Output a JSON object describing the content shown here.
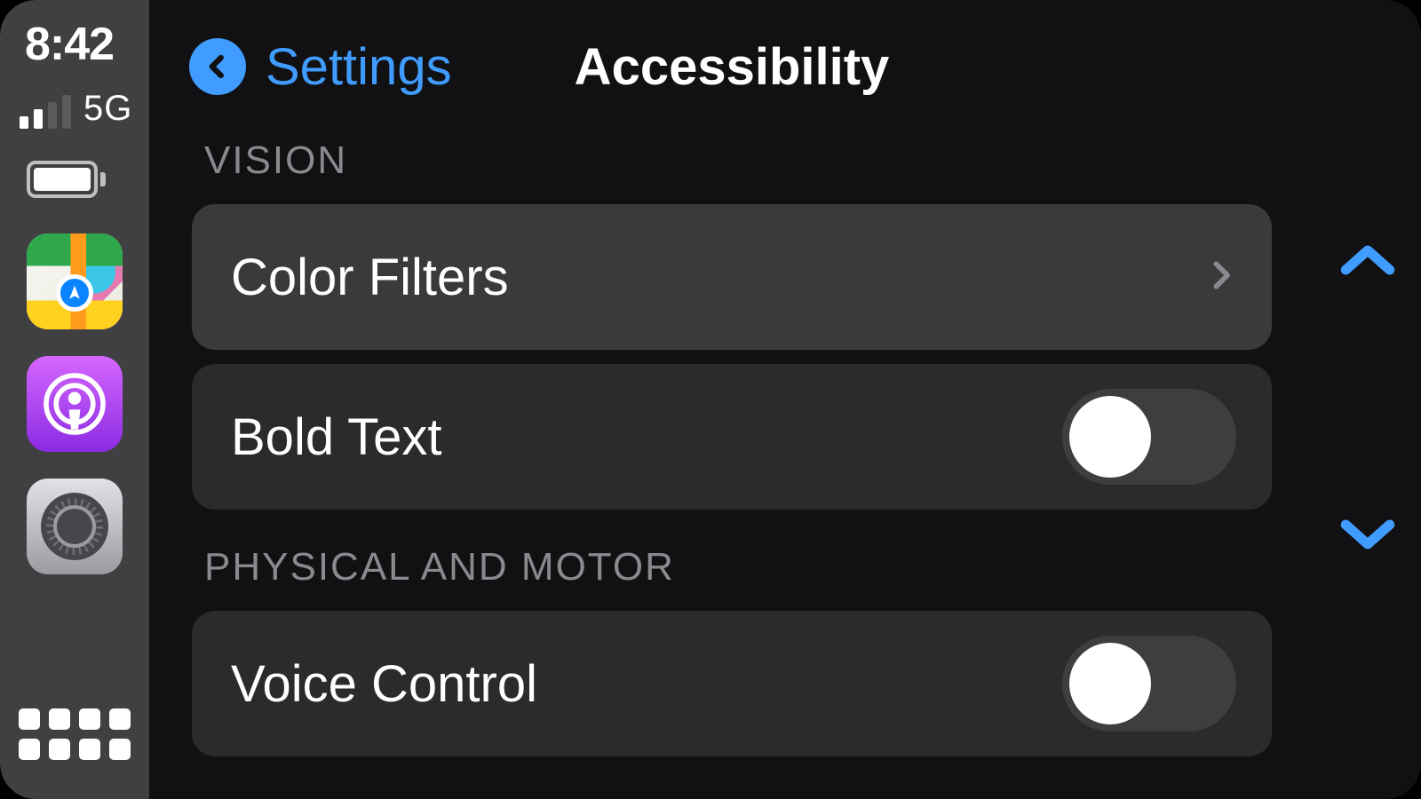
{
  "statusbar": {
    "time": "8:42",
    "network_type": "5G",
    "signal_bars_active": 2,
    "signal_bars_total": 4,
    "battery_percent": 100
  },
  "dock": {
    "apps": [
      {
        "id": "maps",
        "name": "Maps"
      },
      {
        "id": "podcasts",
        "name": "Podcasts"
      },
      {
        "id": "settings",
        "name": "Settings"
      }
    ],
    "home_button": "App Grid"
  },
  "nav": {
    "back_label": "Settings",
    "title": "Accessibility"
  },
  "sections": [
    {
      "header": "VISION",
      "rows": [
        {
          "key": "color_filters",
          "label": "Color Filters",
          "kind": "disclosure"
        },
        {
          "key": "bold_text",
          "label": "Bold Text",
          "kind": "switch",
          "on": false
        }
      ]
    },
    {
      "header": "PHYSICAL AND MOTOR",
      "rows": [
        {
          "key": "voice_control",
          "label": "Voice Control",
          "kind": "switch",
          "on": false
        }
      ]
    }
  ],
  "colors": {
    "accent": "#409cff",
    "cell_bg": "#2b2b2d",
    "cell_hl": "#3a3a3c",
    "panel_bg": "#111113",
    "rail_bg": "#404042"
  }
}
